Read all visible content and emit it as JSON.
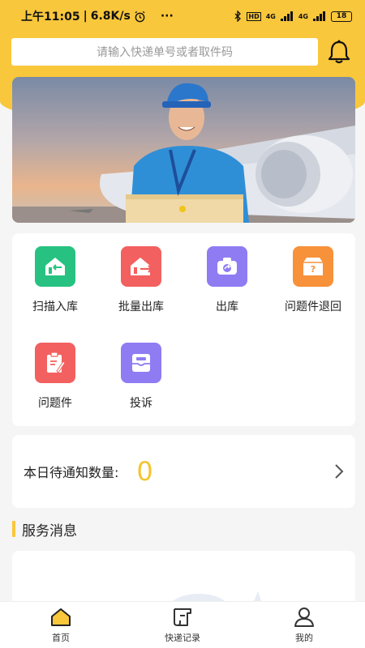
{
  "status_bar": {
    "time": "上午11:05",
    "speed": "6.8K/s",
    "more": "···",
    "network1": "4G",
    "network2": "4G",
    "hd": "HD",
    "battery": "18"
  },
  "search": {
    "placeholder": "请输入快递单号或者取件码"
  },
  "actions": [
    {
      "label": "扫描入库",
      "icon": "scan-in-icon",
      "color": "#27c281"
    },
    {
      "label": "批量出库",
      "icon": "batch-out-icon",
      "color": "#f2605f"
    },
    {
      "label": "出库",
      "icon": "camera-out-icon",
      "color": "#8f7cf3"
    },
    {
      "label": "问题件退回",
      "icon": "problem-return-icon",
      "color": "#f7913a"
    },
    {
      "label": "问题件",
      "icon": "problem-item-icon",
      "color": "#f2605f"
    },
    {
      "label": "投诉",
      "icon": "complaint-icon",
      "color": "#8f7cf3"
    }
  ],
  "notice": {
    "label": "本日待通知数量:",
    "count": "0"
  },
  "section": {
    "title": "服务消息"
  },
  "tabs": [
    {
      "label": "首页",
      "icon": "home-icon",
      "active": true
    },
    {
      "label": "快递记录",
      "icon": "records-icon",
      "active": false
    },
    {
      "label": "我的",
      "icon": "profile-icon",
      "active": false
    }
  ],
  "colors": {
    "brand_yellow": "#f9c73b",
    "count_yellow": "#f4c430"
  }
}
